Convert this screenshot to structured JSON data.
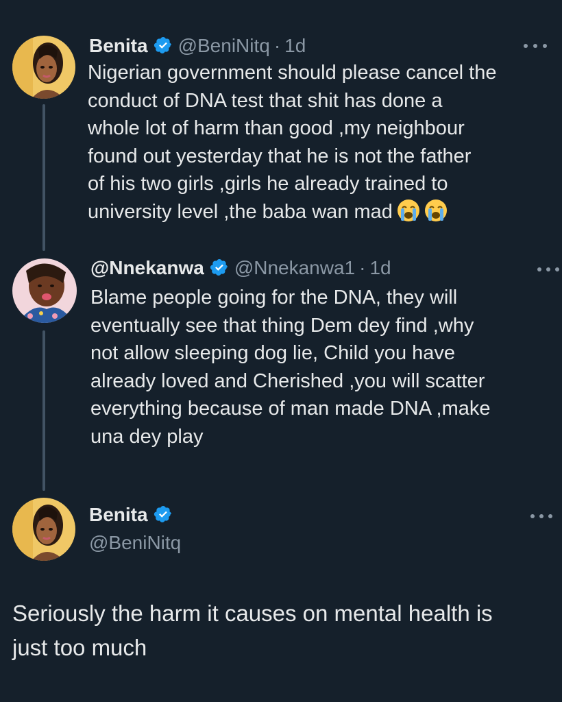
{
  "tweet1": {
    "name": "Benita",
    "handle": "@BeniNitq",
    "separator": "·",
    "time": "1d",
    "text": "Nigerian government should please  cancel the\nconduct of DNA test that shit has done a\nwhole lot of harm than good ,my neighbour\nfound out yesterday  that he is not the father\nof his two girls ,girls he already  trained to\nuniversity  level ,the baba wan mad",
    "emojis": [
      "😭",
      "😭"
    ]
  },
  "tweet2": {
    "name": "@Nnekanwa",
    "handle": "@Nnekanwa1",
    "separator": "·",
    "time": "1d",
    "text": "Blame people going for the DNA, they will\neventually see that thing Dem dey find ,why\nnot allow sleeping dog lie, Child you have\nalready loved and Cherished ,you will scatter\neverything because of man made DNA ,make\nuna dey play"
  },
  "main_tweet": {
    "name": "Benita",
    "handle": "@BeniNitq",
    "text": "Seriously the harm it causes on mental health is\njust too much"
  },
  "colors": {
    "background": "#15202b",
    "text": "#e7e9ea",
    "secondary": "#8b98a5",
    "verified": "#1d9bf0",
    "thread_line": "#425364"
  },
  "icons": {
    "verified": "verified-badge-icon",
    "more": "more-options-icon"
  }
}
